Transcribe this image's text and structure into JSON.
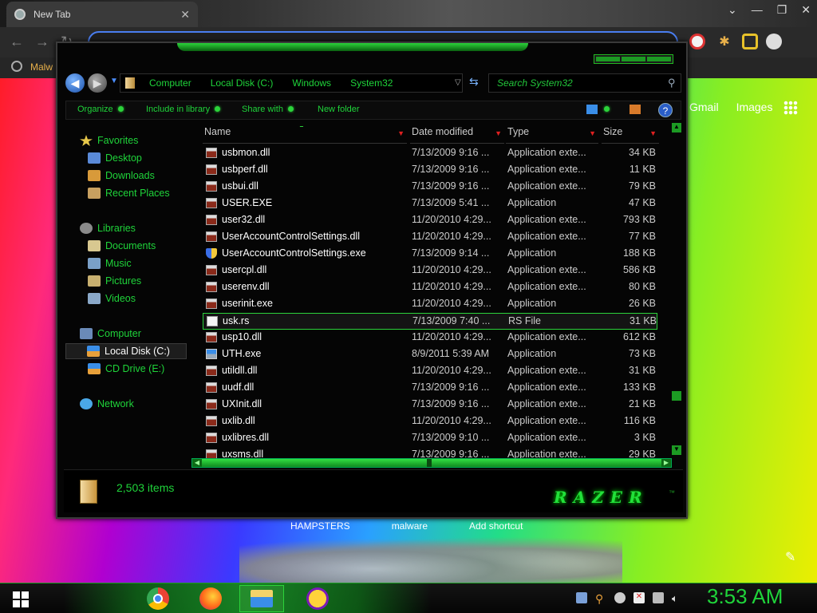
{
  "browser": {
    "tab_title": "New Tab",
    "bookmark_label": "Malw",
    "google_links": [
      "Gmail",
      "Images"
    ],
    "shortcuts": [
      "HAMPSTERS",
      "malware",
      "Add shortcut"
    ]
  },
  "explorer": {
    "breadcrumbs": [
      "Computer",
      "Local Disk (C:)",
      "Windows",
      "System32"
    ],
    "search_placeholder": "Search System32",
    "commands": [
      "Organize",
      "Include in library",
      "Share with",
      "New folder"
    ],
    "nav": {
      "favorites": {
        "label": "Favorites",
        "items": [
          "Desktop",
          "Downloads",
          "Recent Places"
        ]
      },
      "libraries": {
        "label": "Libraries",
        "items": [
          "Documents",
          "Music",
          "Pictures",
          "Videos"
        ]
      },
      "computer": {
        "label": "Computer",
        "items": [
          "Local Disk (C:)",
          "CD Drive (E:)"
        ]
      },
      "network": {
        "label": "Network"
      }
    },
    "columns": [
      "Name",
      "Date modified",
      "Type",
      "Size"
    ],
    "files": [
      {
        "name": "usbmon.dll",
        "date": "7/13/2009 9:16 ...",
        "type": "Application exte...",
        "size": "34 KB",
        "icon": "dll"
      },
      {
        "name": "usbperf.dll",
        "date": "7/13/2009 9:16 ...",
        "type": "Application exte...",
        "size": "11 KB",
        "icon": "dll"
      },
      {
        "name": "usbui.dll",
        "date": "7/13/2009 9:16 ...",
        "type": "Application exte...",
        "size": "79 KB",
        "icon": "dll"
      },
      {
        "name": "USER.EXE",
        "date": "7/13/2009 5:41 ...",
        "type": "Application",
        "size": "47 KB",
        "icon": "dll"
      },
      {
        "name": "user32.dll",
        "date": "11/20/2010 4:29...",
        "type": "Application exte...",
        "size": "793 KB",
        "icon": "dll"
      },
      {
        "name": "UserAccountControlSettings.dll",
        "date": "11/20/2010 4:29...",
        "type": "Application exte...",
        "size": "77 KB",
        "icon": "dll"
      },
      {
        "name": "UserAccountControlSettings.exe",
        "date": "7/13/2009 9:14 ...",
        "type": "Application",
        "size": "188 KB",
        "icon": "shield"
      },
      {
        "name": "usercpl.dll",
        "date": "11/20/2010 4:29...",
        "type": "Application exte...",
        "size": "586 KB",
        "icon": "dll"
      },
      {
        "name": "userenv.dll",
        "date": "11/20/2010 4:29...",
        "type": "Application exte...",
        "size": "80 KB",
        "icon": "dll"
      },
      {
        "name": "userinit.exe",
        "date": "11/20/2010 4:29...",
        "type": "Application",
        "size": "26 KB",
        "icon": "dll"
      },
      {
        "name": "usk.rs",
        "date": "7/13/2009 7:40 ...",
        "type": "RS File",
        "size": "31 KB",
        "icon": "doc",
        "selected": true
      },
      {
        "name": "usp10.dll",
        "date": "11/20/2010 4:29...",
        "type": "Application exte...",
        "size": "612 KB",
        "icon": "dll"
      },
      {
        "name": "UTH.exe",
        "date": "8/9/2011 5:39 AM",
        "type": "Application",
        "size": "73 KB",
        "icon": "app"
      },
      {
        "name": "utildll.dll",
        "date": "11/20/2010 4:29...",
        "type": "Application exte...",
        "size": "31 KB",
        "icon": "dll"
      },
      {
        "name": "uudf.dll",
        "date": "7/13/2009 9:16 ...",
        "type": "Application exte...",
        "size": "133 KB",
        "icon": "dll"
      },
      {
        "name": "UXInit.dll",
        "date": "7/13/2009 9:16 ...",
        "type": "Application exte...",
        "size": "21 KB",
        "icon": "dll"
      },
      {
        "name": "uxlib.dll",
        "date": "11/20/2010 4:29...",
        "type": "Application exte...",
        "size": "116 KB",
        "icon": "dll"
      },
      {
        "name": "uxlibres.dll",
        "date": "7/13/2009 9:10 ...",
        "type": "Application exte...",
        "size": "3 KB",
        "icon": "dll"
      },
      {
        "name": "uxsms.dll",
        "date": "7/13/2009 9:16 ...",
        "type": "Application exte...",
        "size": "29 KB",
        "icon": "dll"
      }
    ],
    "item_count": "2,503 items",
    "brand": "RAZER"
  },
  "taskbar": {
    "clock": "3:53 AM",
    "apps": [
      "chrome-icon",
      "firefox-icon",
      "explorer-icon",
      "yahoo-icon"
    ]
  },
  "colors": {
    "accent_green": "#1fd43a",
    "sort_red": "#e02020",
    "window_bg": "#050505"
  }
}
